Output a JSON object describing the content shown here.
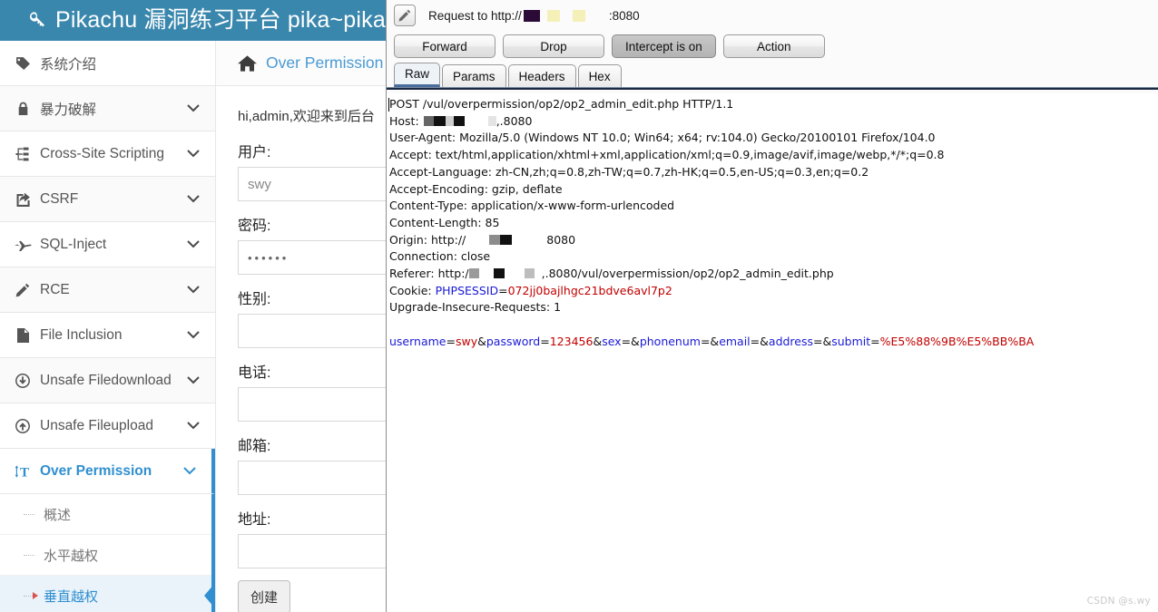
{
  "pikachu": {
    "header": {
      "title": "Pikachu 漏洞练习平台 pika~pika",
      "logo_icon": "search-key-icon",
      "bg_color": "#3a87ad"
    },
    "sidebar": {
      "items": [
        {
          "label": "系统介绍",
          "icon": "tag-icon",
          "chevron": "",
          "expandable": false
        },
        {
          "label": "暴力破解",
          "icon": "lock-icon",
          "chevron": "⌄",
          "expandable": true
        },
        {
          "label": "Cross-Site Scripting",
          "icon": "sitemap-icon",
          "chevron": "⌄",
          "expandable": true
        },
        {
          "label": "CSRF",
          "icon": "share-square-icon",
          "chevron": "⌄",
          "expandable": true
        },
        {
          "label": "SQL-Inject",
          "icon": "plane-icon",
          "chevron": "⌄",
          "expandable": true
        },
        {
          "label": "RCE",
          "icon": "pencil-icon",
          "chevron": "⌄",
          "expandable": true
        },
        {
          "label": "File Inclusion",
          "icon": "file-icon",
          "chevron": "⌄",
          "expandable": true
        },
        {
          "label": "Unsafe Filedownload",
          "icon": "download-circle-icon",
          "chevron": "⌄",
          "expandable": true
        },
        {
          "label": "Unsafe Fileupload",
          "icon": "upload-circle-icon",
          "chevron": "⌄",
          "expandable": true
        },
        {
          "label": "Over Permission",
          "icon": "text-height-icon",
          "chevron": "⌄",
          "expandable": true,
          "active": true
        }
      ],
      "sub_items": [
        {
          "label": "概述",
          "active": false
        },
        {
          "label": "水平越权",
          "active": false
        },
        {
          "label": "垂直越权",
          "active": true
        }
      ],
      "active_color": "#2f8fd0"
    },
    "main": {
      "breadcrumb": {
        "icon": "home-icon",
        "text": "Over Permission"
      },
      "greeting": "hi,admin,欢迎来到后台",
      "fields": [
        {
          "label": "用户:",
          "value": "swy",
          "type": "text"
        },
        {
          "label": "密码:",
          "value": "••••••",
          "type": "password"
        },
        {
          "label": "性别:",
          "value": "",
          "type": "text"
        },
        {
          "label": "电话:",
          "value": "",
          "type": "text"
        },
        {
          "label": "邮箱:",
          "value": "",
          "type": "text"
        },
        {
          "label": "地址:",
          "value": "",
          "type": "text"
        }
      ],
      "submit_label": "创建"
    }
  },
  "burp": {
    "title_prefix": "Request to http://",
    "title_port": ":8080",
    "pencil_icon": "pencil-icon",
    "buttons": [
      {
        "label": "Forward",
        "pressed": false
      },
      {
        "label": "Drop",
        "pressed": false
      },
      {
        "label": "Intercept is on",
        "pressed": true
      },
      {
        "label": "Action",
        "pressed": false
      }
    ],
    "tabs": [
      {
        "label": "Raw",
        "active": true
      },
      {
        "label": "Params",
        "active": false
      },
      {
        "label": "Headers",
        "active": false
      },
      {
        "label": "Hex",
        "active": false
      }
    ],
    "request": {
      "request_line": "POST /vul/overpermission/op2/op2_admin_edit.php HTTP/1.1",
      "host_name": "Host:",
      "host_suffix": ",.8080",
      "user_agent": "User-Agent: Mozilla/5.0 (Windows NT 10.0; Win64; x64; rv:104.0) Gecko/20100101 Firefox/104.0",
      "accept": "Accept: text/html,application/xhtml+xml,application/xml;q=0.9,image/avif,image/webp,*/*;q=0.8",
      "accept_language": "Accept-Language: zh-CN,zh;q=0.8,zh-TW;q=0.7,zh-HK;q=0.5,en-US;q=0.3,en;q=0.2",
      "accept_encoding": "Accept-Encoding: gzip, deflate",
      "content_type": "Content-Type: application/x-www-form-urlencoded",
      "content_length": "Content-Length: 85",
      "origin_name": "Origin: http://",
      "origin_port": "8080",
      "connection": "Connection: close",
      "referer_name": "Referer: http:/",
      "referer_suffix": ",.8080/vul/overpermission/op2/op2_admin_edit.php",
      "cookie_label": "Cookie: ",
      "cookie_key": "PHPSESSID",
      "cookie_eq": "=",
      "cookie_value": "072jj0bajlhgc21bdve6avl7p2",
      "upgrade": "Upgrade-Insecure-Requests: 1",
      "body": [
        {
          "text": "username",
          "color": "#1a1ad6"
        },
        {
          "text": "=",
          "color": "#111111"
        },
        {
          "text": "swy",
          "color": "#c10000"
        },
        {
          "text": "&",
          "color": "#111111"
        },
        {
          "text": "password",
          "color": "#1a1ad6"
        },
        {
          "text": "=",
          "color": "#111111"
        },
        {
          "text": "123456",
          "color": "#c10000"
        },
        {
          "text": "&",
          "color": "#111111"
        },
        {
          "text": "sex",
          "color": "#1a1ad6"
        },
        {
          "text": "=&",
          "color": "#111111"
        },
        {
          "text": "phonenum",
          "color": "#1a1ad6"
        },
        {
          "text": "=&",
          "color": "#111111"
        },
        {
          "text": "email",
          "color": "#1a1ad6"
        },
        {
          "text": "=&",
          "color": "#111111"
        },
        {
          "text": "address",
          "color": "#1a1ad6"
        },
        {
          "text": "=&",
          "color": "#111111"
        },
        {
          "text": "submit",
          "color": "#1a1ad6"
        },
        {
          "text": "=",
          "color": "#111111"
        },
        {
          "text": "%E5%88%9B%E5%BB%BA",
          "color": "#c10000"
        }
      ]
    }
  },
  "watermark": "CSDN @s.wy"
}
